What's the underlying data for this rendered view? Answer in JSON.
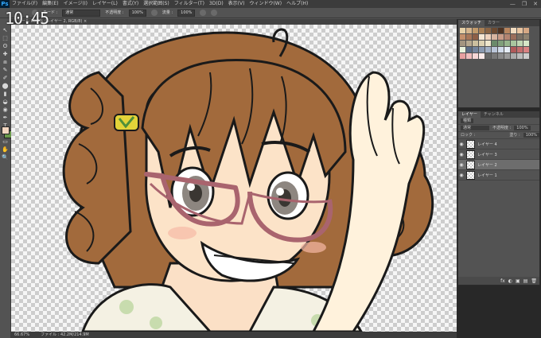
{
  "app": {
    "logo": "Ps"
  },
  "menu": [
    "ファイル(F)",
    "編集(E)",
    "イメージ(I)",
    "レイヤー(L)",
    "書式(Y)",
    "選択範囲(S)",
    "フィルター(T)",
    "3D(D)",
    "表示(V)",
    "ウィンドウ(W)",
    "ヘルプ(H)"
  ],
  "window_controls": [
    "—",
    "❐",
    "✕"
  ],
  "options_bar": {
    "mode_label": "モード :",
    "mode_value": "通常",
    "opacity_label": "不透明度 :",
    "opacity_value": "100%",
    "flow_label": "流量 :",
    "flow_value": "100%"
  },
  "clock": "10:45",
  "document_tab": "ツール  66.7% (レイヤー 2, RGB/8) ×",
  "status": {
    "zoom": "66.67%",
    "doc": "ファイル : 42.2M/214.9M"
  },
  "tools": [
    "↖",
    "⬚",
    "ʘ",
    "✚",
    "⧈",
    "✎",
    "✐",
    "⬤",
    "▮",
    "◒",
    "◉",
    "✒",
    "T",
    "↗",
    "▭",
    "✋",
    "🔍"
  ],
  "swatches_panel": {
    "tabs": [
      "スウォッチ",
      "カラー"
    ]
  },
  "swatch_colors": [
    "#e6d0a7",
    "#d5b48c",
    "#c19a6b",
    "#a98056",
    "#8a6443",
    "#6c4a31",
    "#4e3322",
    "#b9865f",
    "#f2dcc0",
    "#e8c4a0",
    "#d6a884",
    "#c48f6b",
    "#a87658",
    "#8e5f46",
    "#f5e6d3",
    "#efd2bc",
    "#d9b5a0",
    "#c99b86",
    "#b38470",
    "#9b6e5b",
    "#7a7064",
    "#8e8270",
    "#a39580",
    "#b7a98f",
    "#cbbf9f",
    "#ddd2b2",
    "#eee6cc",
    "#6a8a6a",
    "#7f9f7a",
    "#95b48c",
    "#a9c69f",
    "#c0d6b3",
    "#d6e6c7",
    "#e8f2dc",
    "#5c6d86",
    "#73839b",
    "#8a99b0",
    "#a2b0c5",
    "#bac5d8",
    "#d1dbea",
    "#e6edf6",
    "#b05a5a",
    "#c46e6e",
    "#d88282",
    "#e8a0a0",
    "#f0bdbd",
    "#f6d6d6",
    "#fbeaea",
    "#666",
    "#777",
    "#888",
    "#999",
    "#aaa",
    "#bbb",
    "#ccc"
  ],
  "layers_panel": {
    "tabs": [
      "レイヤー",
      "チャンネル"
    ],
    "filter_label": "種類",
    "blend_mode": "通常",
    "opacity_label": "不透明度 :",
    "opacity_value": "100%",
    "lock_label": "ロック :",
    "fill_label": "塗り :",
    "fill_value": "100%",
    "layers": [
      {
        "name": "レイヤー 4",
        "selected": false
      },
      {
        "name": "レイヤー 3",
        "selected": false
      },
      {
        "name": "レイヤー 2",
        "selected": true
      },
      {
        "name": "レイヤー 1",
        "selected": false
      }
    ],
    "bottom_icons": [
      "fx",
      "◐",
      "▣",
      "▤",
      "🗑"
    ]
  }
}
